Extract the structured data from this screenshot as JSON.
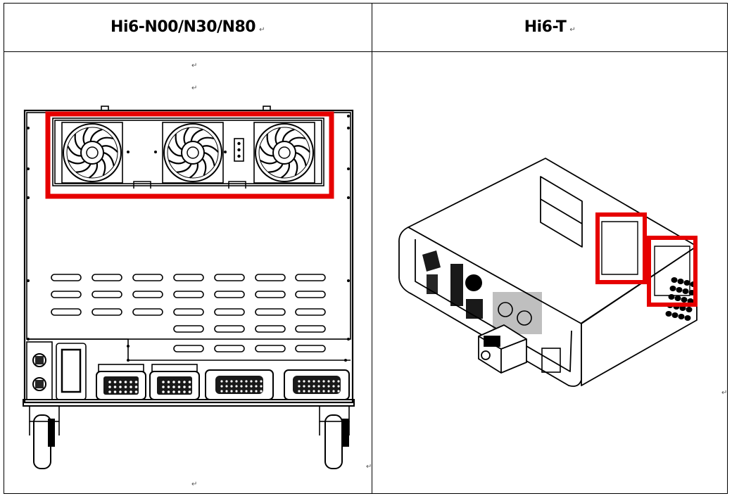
{
  "table": {
    "headers": [
      "Hi6-N00/N30/N80",
      "Hi6-T"
    ],
    "paragraph_mark": "↵"
  },
  "figures": [
    {
      "icon": "controller-rear-view-drawing",
      "highlight": "fan-area",
      "highlight_color": "#e60000"
    },
    {
      "icon": "controller-isometric-drawing",
      "highlight": "vent-areas",
      "highlight_color": "#e60000"
    }
  ]
}
